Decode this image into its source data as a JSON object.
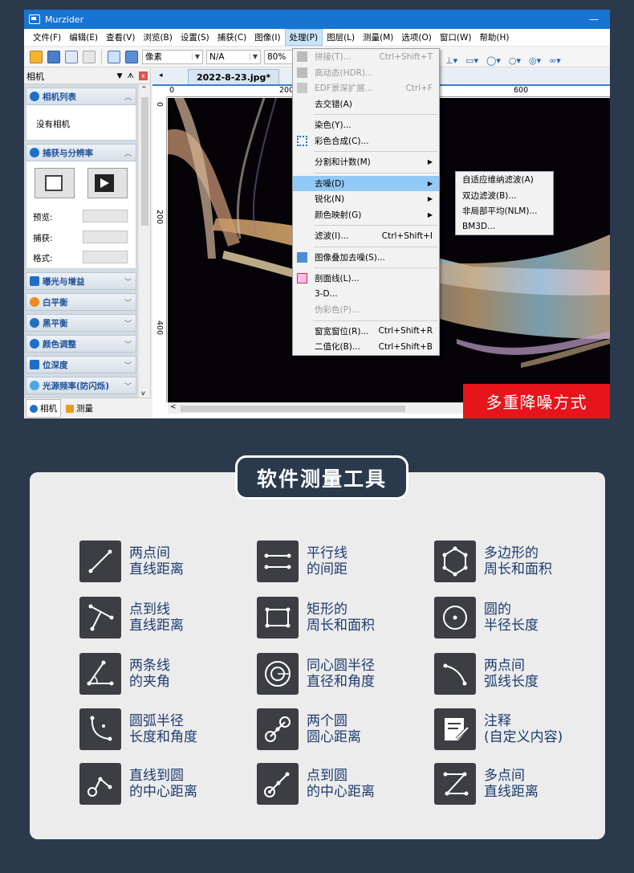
{
  "window": {
    "title": "Murzider",
    "minimize_glyph": "—"
  },
  "menubar": [
    "文件(F)",
    "编辑(E)",
    "查看(V)",
    "浏览(B)",
    "设置(S)",
    "捕获(C)",
    "图像(I)",
    "处理(P)",
    "图层(L)",
    "测量(M)",
    "选项(O)",
    "窗口(W)",
    "帮助(H)"
  ],
  "toolbar": {
    "unit": "像素",
    "value": "N/A",
    "zoom": "80%"
  },
  "left_panel": {
    "title": "相机",
    "pin_glyph": "ᗑ",
    "close_glyph": "x",
    "sections": {
      "camera_list": {
        "title": "相机列表",
        "empty": "没有相机"
      },
      "capture": {
        "title": "捕获与分辨率",
        "preview": "预览:",
        "capture": "捕获:",
        "format": "格式:"
      },
      "exposure": "曝光与增益",
      "white_balance": "白平衡",
      "black_balance": "黑平衡",
      "color_adjust": "颜色调整",
      "bit_depth": "位深度",
      "light_freq": "光源频率(防闪烁)"
    },
    "tabs": {
      "camera": "相机",
      "measure": "测量"
    }
  },
  "document": {
    "tab": "2022-8-23.jpg*",
    "ruler_h": [
      "0",
      "200",
      "600"
    ],
    "ruler_v": [
      "0",
      "200",
      "400"
    ]
  },
  "process_menu": [
    {
      "label": "拼接(T)...",
      "shortcut": "Ctrl+Shift+T",
      "disabled": true
    },
    {
      "label": "高动态(HDR)...",
      "shortcut": "",
      "disabled": true
    },
    {
      "label": "EDF景深扩展...",
      "shortcut": "Ctrl+F",
      "disabled": true
    },
    {
      "label": "去交错(A)",
      "shortcut": ""
    },
    {
      "label": "染色(Y)...",
      "shortcut": ""
    },
    {
      "label": "彩色合成(C)...",
      "shortcut": ""
    },
    {
      "label": "分割和计数(M)",
      "shortcut": ""
    },
    {
      "label": "去噪(D)",
      "shortcut": ""
    },
    {
      "label": "锐化(N)",
      "shortcut": ""
    },
    {
      "label": "颜色映射(G)",
      "shortcut": ""
    },
    {
      "label": "滤波(I)...",
      "shortcut": "Ctrl+Shift+I"
    },
    {
      "label": "图像叠加去噪(S)...",
      "shortcut": ""
    },
    {
      "label": "剖面线(L)...",
      "shortcut": ""
    },
    {
      "label": "3-D...",
      "shortcut": ""
    },
    {
      "label": "伪彩色(P)...",
      "shortcut": "",
      "disabled": true
    },
    {
      "label": "窗宽窗位(R)...",
      "shortcut": "Ctrl+Shift+R"
    },
    {
      "label": "二值化(B)...",
      "shortcut": "Ctrl+Shift+B"
    }
  ],
  "denoise_submenu": [
    "自适应维纳滤波(A)",
    "双边滤波(B)...",
    "非局部平均(NLM)...",
    "BM3D..."
  ],
  "banner": "多重降噪方式",
  "tools_title": "软件测量工具",
  "tools": [
    {
      "l1": "两点间",
      "l2": "直线距离",
      "icon": "line-icon"
    },
    {
      "l1": "平行线",
      "l2": "的间距",
      "icon": "parallel-lines-icon"
    },
    {
      "l1": "多边形的",
      "l2": "周长和面积",
      "icon": "polygon-icon"
    },
    {
      "l1": "点到线",
      "l2": "直线距离",
      "icon": "point-to-line-icon"
    },
    {
      "l1": "矩形的",
      "l2": "周长和面积",
      "icon": "rectangle-icon"
    },
    {
      "l1": "圆的",
      "l2": "半径长度",
      "icon": "circle-icon"
    },
    {
      "l1": "两条线",
      "l2": "的夹角",
      "icon": "angle-icon"
    },
    {
      "l1": "同心圆半径",
      "l2": "直径和角度",
      "icon": "concentric-circles-icon"
    },
    {
      "l1": "两点间",
      "l2": "弧线长度",
      "icon": "arc-icon"
    },
    {
      "l1": "圆弧半径",
      "l2": "长度和角度",
      "icon": "arc-radius-icon"
    },
    {
      "l1": "两个圆",
      "l2": "圆心距离",
      "icon": "two-circles-icon"
    },
    {
      "l1": "注释",
      "l2": "(自定义内容)",
      "icon": "annotation-icon"
    },
    {
      "l1": "直线到圆",
      "l2": "的中心距离",
      "icon": "line-to-circle-icon"
    },
    {
      "l1": "点到圆",
      "l2": "的中心距离",
      "icon": "point-to-circle-icon"
    },
    {
      "l1": "多点间",
      "l2": "直线距离",
      "icon": "polyline-icon"
    }
  ]
}
